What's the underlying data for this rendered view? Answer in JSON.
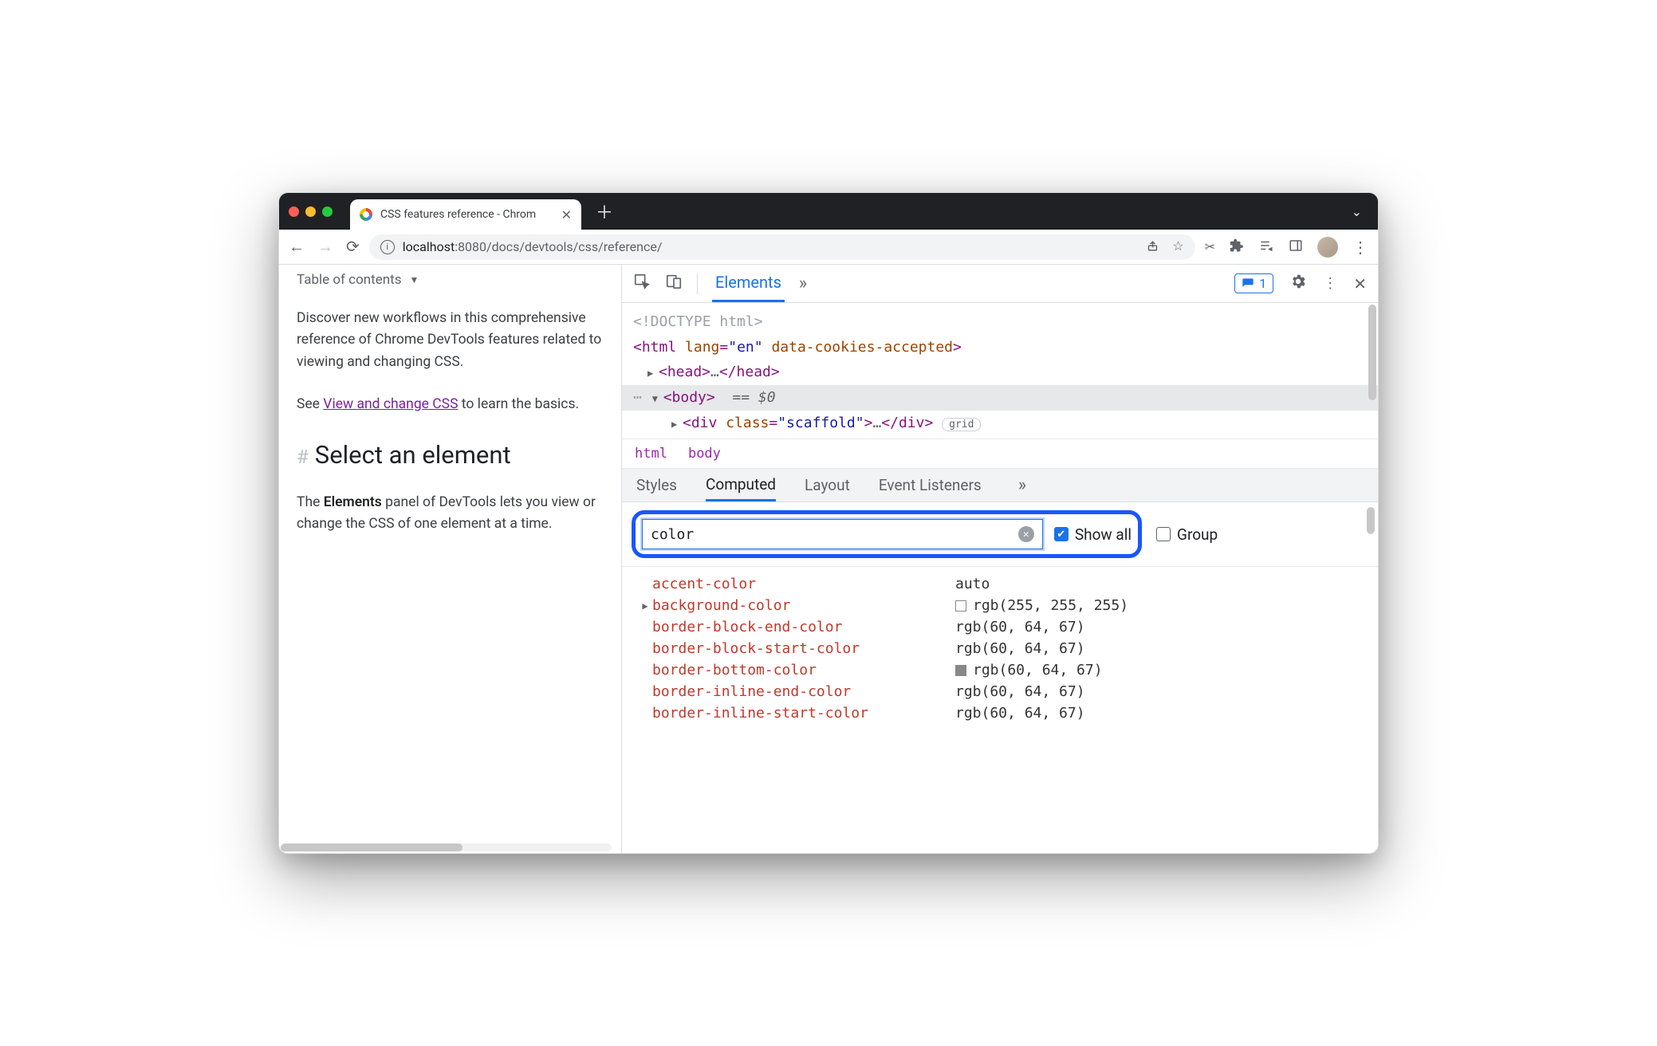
{
  "tab": {
    "title": "CSS features reference - Chrom"
  },
  "address": {
    "host": "localhost",
    "port": ":8080",
    "path": "/docs/devtools/css/reference/"
  },
  "page": {
    "toc_label": "Table of contents",
    "intro": "Discover new workflows in this comprehensive reference of Chrome DevTools features related to viewing and changing CSS.",
    "see_prefix": "See ",
    "see_link": "View and change CSS",
    "see_suffix": " to learn the basics.",
    "heading": "Select an element",
    "elements_word": "Elements",
    "body_para_prefix": "The ",
    "body_para_suffix": " panel of DevTools lets you view or change the CSS of one element at a time."
  },
  "devtools": {
    "main_tab": "Elements",
    "issues_count": "1",
    "dom": {
      "doctype": "<!DOCTYPE html>",
      "html_open": "<html ",
      "html_attr1_name": "lang",
      "html_attr1_val": "\"en\"",
      "html_attr2_name": "data-cookies-accepted",
      "html_close": ">",
      "head_open": "<head>",
      "head_ell": "…",
      "head_close": "</head>",
      "body_open": "<body>",
      "eq0": "== $0",
      "div_open": "<div ",
      "div_attr_name": "class",
      "div_attr_val": "\"scaffold\"",
      "div_mid": ">",
      "div_ell": "…",
      "div_close": "</div>",
      "grid_pill": "grid"
    },
    "crumbs": {
      "a": "html",
      "b": "body"
    },
    "subtabs": {
      "styles": "Styles",
      "computed": "Computed",
      "layout": "Layout",
      "listeners": "Event Listeners"
    },
    "filter": {
      "value": "color",
      "show_all": "Show all",
      "group": "Group"
    },
    "computed": [
      {
        "expand": "",
        "prop": "accent-color",
        "val": "auto",
        "swatch": ""
      },
      {
        "expand": "▶",
        "prop": "background-color",
        "val": "rgb(255, 255, 255)",
        "swatch": "white"
      },
      {
        "expand": "",
        "prop": "border-block-end-color",
        "val": "rgb(60, 64, 67)",
        "swatch": ""
      },
      {
        "expand": "",
        "prop": "border-block-start-color",
        "val": "rgb(60, 64, 67)",
        "swatch": ""
      },
      {
        "expand": "",
        "prop": "border-bottom-color",
        "val": "rgb(60, 64, 67)",
        "swatch": "gray"
      },
      {
        "expand": "",
        "prop": "border-inline-end-color",
        "val": "rgb(60, 64, 67)",
        "swatch": ""
      },
      {
        "expand": "",
        "prop": "border-inline-start-color",
        "val": "rgb(60, 64, 67)",
        "swatch": ""
      }
    ]
  }
}
